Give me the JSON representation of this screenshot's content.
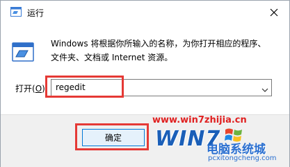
{
  "window": {
    "title": "运行",
    "icon": "run-icon"
  },
  "description": {
    "line1": "Windows 将根据你所输入的名称，为你打开相应的程序、",
    "line2": "文件夹、文档或 Internet 资源。"
  },
  "open_field": {
    "label_prefix": "打开(",
    "label_accel": "O",
    "label_suffix": "):",
    "value": "regedit"
  },
  "buttons": {
    "ok_label": "确定"
  },
  "watermark": {
    "url": "www.win7zhijia.cn",
    "logo_text": "WIN7",
    "cn_text": "电脑系统城",
    "domain": "pcxitongcheng.com"
  },
  "colors": {
    "highlight_red": "#e53935",
    "button_accent": "#0078d7",
    "watermark_red": "#e02020",
    "watermark_blue": "#1b5fb8"
  }
}
